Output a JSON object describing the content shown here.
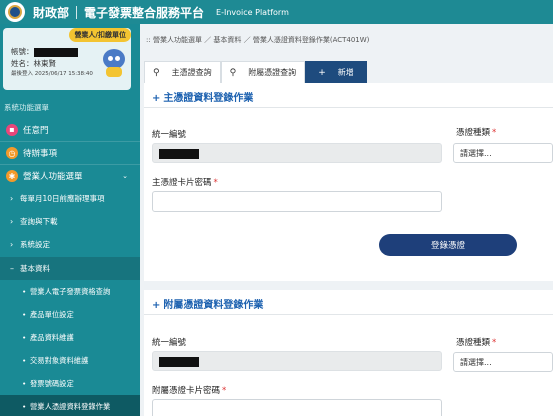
{
  "header": {
    "agency": "財政部",
    "title": "電子發票整合服務平台",
    "title_en": "E-Invoice Platform"
  },
  "user": {
    "role_badge": "營業人/扣繳單位",
    "account_label": "帳號：",
    "name_label": "姓名：",
    "name_value": "林東賢",
    "last_login": "最後登入 2025/06/17 15:38:40"
  },
  "sidebar": {
    "menu_header": "系統功能選單",
    "items": [
      {
        "label": "任意門",
        "color": "#e8467a"
      },
      {
        "label": "待辦事項",
        "color": "#f39a2a"
      },
      {
        "label": "營業人功能選單",
        "color": "#f39a2a"
      }
    ],
    "sub_items": [
      {
        "label": "每單月10日前應辦理事項"
      },
      {
        "label": "查詢與下載"
      },
      {
        "label": "系統設定"
      },
      {
        "label": "基本資料"
      }
    ],
    "basic_data_items": [
      {
        "label": "營業人電子發票資格查詢"
      },
      {
        "label": "產品單位設定"
      },
      {
        "label": "產品資料維護"
      },
      {
        "label": "交易對象資料維護"
      },
      {
        "label": "發票號碼設定"
      },
      {
        "label": "營業人憑證資料登錄作業"
      }
    ]
  },
  "breadcrumb": ":: 營業人功能選單 ／ 基本資料 ／ 營業人憑證資料登錄作業(ACT401W)",
  "tabs": [
    {
      "label": "主憑證查詢",
      "icon": "search-icon"
    },
    {
      "label": "附屬憑證查詢",
      "icon": "search-icon"
    },
    {
      "label": "新增",
      "icon": "plus-icon"
    }
  ],
  "main_form": {
    "title": "主憑證資料登錄作業",
    "ban_label": "統一編號",
    "cert_type_label": "憑證種類",
    "cert_type_value": "請選擇...",
    "pin_label": "主憑證卡片密碼",
    "submit_label": "登錄憑證"
  },
  "sub_form": {
    "title": "附屬憑證資料登錄作業",
    "ban_label": "統一編號",
    "cert_type_label": "憑證種類",
    "cert_type_value": "請選擇...",
    "pin_label": "附屬憑證卡片密碼"
  },
  "colors": {
    "header_bg": "#1e8a94",
    "sidebar_bg": "#1a8a95",
    "active_tab": "#1e4b7e",
    "section_title": "#1e62b0",
    "button": "#1e3f7a"
  }
}
